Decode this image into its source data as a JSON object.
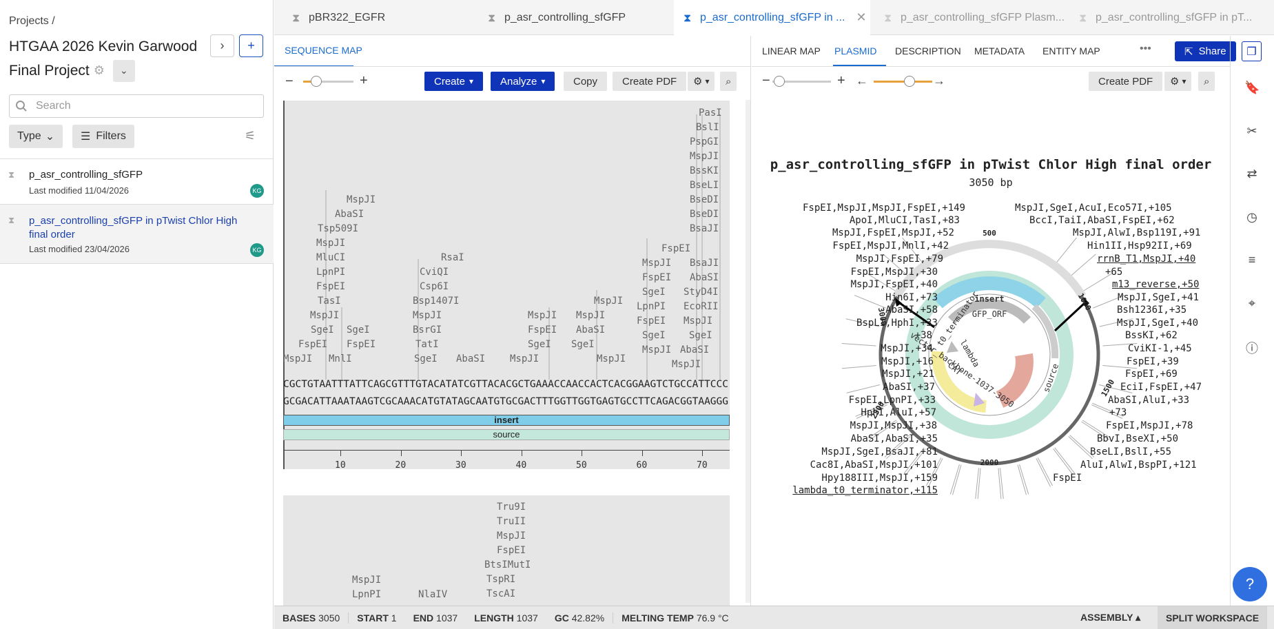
{
  "left": {
    "breadcrumb": "Projects /",
    "title_line1": "HTGAA 2026 Kevin Garwood",
    "title_line2": "Final Project",
    "search_placeholder": "Search",
    "type_filter": "Type",
    "filters_label": "Filters",
    "files": [
      {
        "name": "p_asr_controlling_sfGFP",
        "modified": "Last modified 11/04/2026",
        "avatar": "KG"
      },
      {
        "name_line1": "p_asr_controlling_sfGFP in pTwist Chlor High",
        "name_line2": "final order",
        "modified": "Last modified 23/04/2026",
        "avatar": "KG"
      }
    ]
  },
  "tabs": [
    "pBR322_EGFR",
    "p_asr_controlling_sfGFP",
    "p_asr_controlling_sfGFP in ...",
    "p_asr_controlling_sfGFP Plasm...",
    "p_asr_controlling_sfGFP in pT..."
  ],
  "mid": {
    "subtab": "SEQUENCE MAP",
    "create": "Create",
    "analyze": "Analyze",
    "copy": "Copy",
    "create_pdf": "Create PDF",
    "seq_top": "CGCTGTAATTTATTCAGCGTTTGTACATATCGTTACACGCTGAAACCAACCACTCACGGAAGTCTGCCATTCCC",
    "seq_bottom": "GCGACATTAAATAAGTCGCAAACATGTATAGCAATGTGCGACTTTGGTTGGTGAGTGCCTTCAGACGGTAAGGG",
    "feature_insert": "insert",
    "feature_source": "source",
    "ruler": [
      "10",
      "20",
      "30",
      "40",
      "50",
      "60",
      "70"
    ],
    "enzymes_block1": [
      {
        "t": "PasI"
      },
      {
        "t": "BslI"
      },
      {
        "t": "PspGI"
      },
      {
        "t": "MspJI"
      },
      {
        "t": "BssKI"
      },
      {
        "t": "BseLI"
      },
      {
        "t": "BseDI"
      },
      {
        "t": "BseDI"
      },
      {
        "t": "BsaJI"
      },
      {
        "t": "MspJI"
      },
      {
        "t": "AbaSI"
      },
      {
        "t": "Tsp509I"
      },
      {
        "t": "MspJI"
      },
      {
        "t": "MluCI"
      },
      {
        "t": "LpnPI"
      },
      {
        "t": "FspEI"
      },
      {
        "t": "TasI"
      },
      {
        "t": "MspJI"
      },
      {
        "t": "SgeI"
      },
      {
        "t": "FspEI"
      },
      {
        "t": "MspJI"
      },
      {
        "t": "MnlI"
      },
      {
        "t": "FspEI"
      },
      {
        "t": "SgeI"
      },
      {
        "t": "RsaI"
      },
      {
        "t": "CviQI"
      },
      {
        "t": "Csp6I"
      },
      {
        "t": "Bsp1407I"
      },
      {
        "t": "MspJI"
      },
      {
        "t": "BsrGI"
      },
      {
        "t": "TatI"
      },
      {
        "t": "SgeI"
      },
      {
        "t": "AbaSI"
      },
      {
        "t": "MspJI"
      },
      {
        "t": "FspEI"
      },
      {
        "t": "SgeI"
      },
      {
        "t": "MspJI"
      },
      {
        "t": "MspJI"
      },
      {
        "t": "AbaSI"
      },
      {
        "t": "MspJI"
      },
      {
        "t": "SgeI"
      },
      {
        "t": "MspJI"
      },
      {
        "t": "FspEI"
      },
      {
        "t": "MspJI"
      },
      {
        "t": "FspEI"
      },
      {
        "t": "SgeI"
      },
      {
        "t": "LpnPI"
      },
      {
        "t": "FspEI"
      },
      {
        "t": "SgeI"
      },
      {
        "t": "MspJI"
      },
      {
        "t": "BsaJI"
      },
      {
        "t": "AbaSI"
      },
      {
        "t": "StyD4I"
      },
      {
        "t": "EcoRII"
      },
      {
        "t": "MspJI"
      },
      {
        "t": "SgeI"
      },
      {
        "t": "AbaSI"
      },
      {
        "t": "MspJI"
      }
    ],
    "enzymes_block2": [
      {
        "t": "Tru9I"
      },
      {
        "t": "TruII"
      },
      {
        "t": "MspJI"
      },
      {
        "t": "FspEI"
      },
      {
        "t": "BtsIMutI"
      },
      {
        "t": "TspRI"
      },
      {
        "t": "TscAI"
      },
      {
        "t": "MspJI"
      },
      {
        "t": "LpnPI"
      },
      {
        "t": "NlaIV"
      }
    ]
  },
  "right": {
    "subtabs": [
      "LINEAR MAP",
      "PLASMID",
      "DESCRIPTION",
      "METADATA",
      "ENTITY MAP"
    ],
    "active_subtab": "PLASMID",
    "share": "Share",
    "create_pdf": "Create PDF",
    "map_title": "p_asr_controlling_sfGFP in pTwist Chlor High final order",
    "map_length": "3050 bp",
    "ticks": [
      "500",
      "1000",
      "1500",
      "2000",
      "2500",
      "3000"
    ],
    "features": [
      "insert",
      "GFP_ORF",
      "t0_terminator",
      "lambda",
      "CAT",
      "vector_backbone-1037-3050",
      "source"
    ],
    "annotations_left": [
      "FspEI,MspJI,MspJI,FspEI,+149",
      "ApoI,MluCI,TasI,+83",
      "MspJI,FspEI,MspJI,+52",
      "FspEI,MspJI,MnlI,+42",
      "MspJI,FspEI,+79",
      "FspEI,MspJI,+30",
      "MspJI,FspEI,+40",
      "Hin6I,+73",
      "AbaSI,+58",
      "BspLI,HphI,+33",
      "+38",
      "MspJI,+34",
      "MspJI,+16",
      "MspJI,+21",
      "AbaSI,+37",
      "FspEI,LpnPI,+33",
      "HphI,AluI,+57",
      "MspJI,MspJI,+38",
      "AbaSI,AbaSI,+35",
      "MspJI,SgeI,BsaJI,+81",
      "Cac8I,AbaSI,MspJI,+101",
      "Hpy188III,MspJI,+159",
      "lambda_t0_terminator,+115"
    ],
    "annotations_right": [
      "MspJI,SgeI,AcuI,Eco57I,+105",
      "BccI,TaiI,AbaSI,FspEI,+62",
      "MspJI,AlwI,Bsp119I,+91",
      "Hin1II,Hsp92II,+69",
      "rrnB_T1,MspJI,+40",
      "+65",
      "m13_reverse,+50",
      "MspJI,SgeI,+41",
      "Bsh1236I,+35",
      "MspJI,SgeI,+40",
      "BssKI,+62",
      "CviKI-1,+45",
      "FspEI,+39",
      "FspEI,+69",
      "EciI,FspEI,+47",
      "AbaSI,AluI,+33",
      "+73",
      "FspEI,MspJI,+78",
      "BbvI,BseXI,+50",
      "BseLI,BslI,+55",
      "AluI,AlwI,BspPI,+121",
      "FspEI"
    ]
  },
  "bottom": {
    "bases_label": "BASES",
    "bases": "3050",
    "start_label": "START",
    "start": "1",
    "end_label": "END",
    "end": "1037",
    "length_label": "LENGTH",
    "length": "1037",
    "gc_label": "GC",
    "gc": "42.82%",
    "melt_label": "MELTING TEMP",
    "melt": "76.9 °C",
    "assembly": "ASSEMBLY",
    "split": "SPLIT WORKSPACE"
  }
}
